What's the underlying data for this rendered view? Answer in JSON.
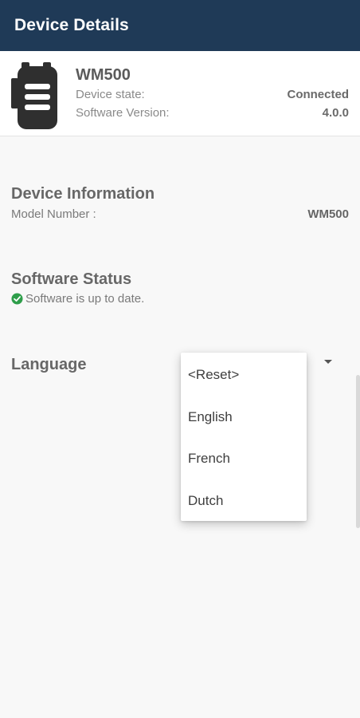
{
  "app_bar": {
    "title": "Device Details"
  },
  "device": {
    "name": "WM500",
    "state_label": "Device state:",
    "state_value": "Connected",
    "software_version_label": "Software Version:",
    "software_version_value": "4.0.0",
    "icon": "radio-device-icon"
  },
  "device_information": {
    "title": "Device Information",
    "model_number_label": "Model Number  :",
    "model_number_value": "WM500"
  },
  "software_status": {
    "title": "Software Status",
    "status_text": "Software is up to date.",
    "status_icon": "check-circle-icon",
    "status_color": "#2e9e4a"
  },
  "language": {
    "title": "Language",
    "dropdown_icon": "dropdown-arrow-icon",
    "options": [
      "<Reset>",
      "English",
      "French",
      "Dutch"
    ]
  },
  "colors": {
    "app_bar": "#1f3a57",
    "background": "#f8f8f8"
  }
}
